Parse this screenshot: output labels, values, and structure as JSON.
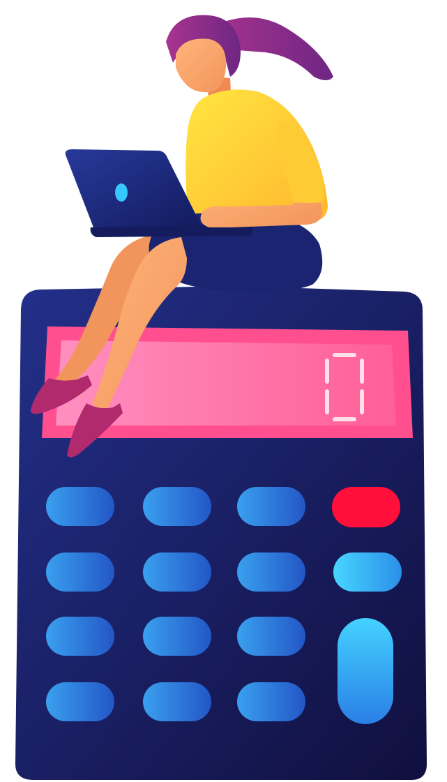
{
  "illustration": {
    "subject": "woman-with-laptop-sitting-on-calculator"
  },
  "calculator": {
    "display_value": "0",
    "key_rows": 4,
    "key_columns": 4
  },
  "colors": {
    "body_dark": "#14164f",
    "body_mid": "#1f2a78",
    "display_pink": "#ff6fa8",
    "display_border": "#ff4f8e",
    "key_blue": "#2f8fe6",
    "key_blue_dark": "#2359c8",
    "key_cyan": "#35c8ff",
    "key_red": "#ff0f3a",
    "hair": "#8e2a8a",
    "shirt": "#ffd43a",
    "skin": "#f7a56b",
    "skirt": "#1b2470",
    "shoes": "#b12a6e",
    "laptop": "#1c2a7a"
  }
}
